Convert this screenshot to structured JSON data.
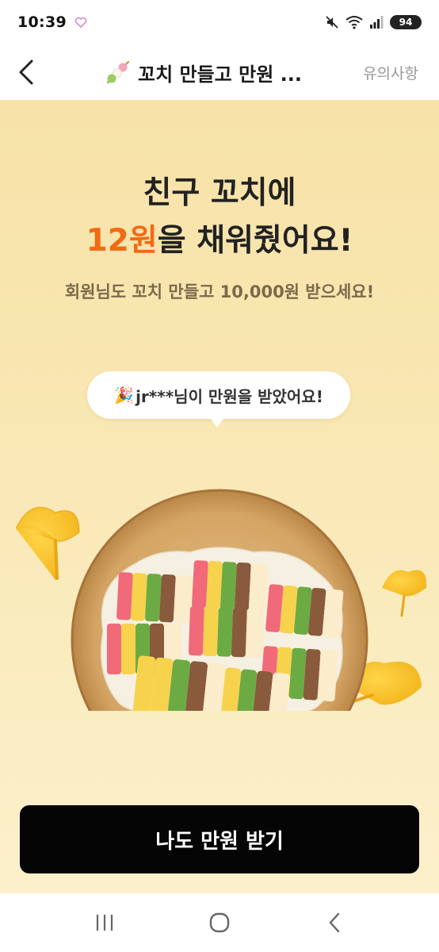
{
  "status_bar": {
    "time": "10:39",
    "battery": "94",
    "icons": [
      "heart-outline-icon",
      "mute-icon",
      "wifi-icon",
      "signal-icon",
      "battery-icon"
    ]
  },
  "header": {
    "back_icon": "chevron-left-icon",
    "title_icon": "skewer-icon",
    "title": "꼬치 만들고 만원 ...",
    "notice_link": "유의사항"
  },
  "hero": {
    "headline_line1": "친구 꼬치에",
    "headline_amount": "12원",
    "headline_rest": "을 채워줬어요!",
    "subline": "회원님도 꼬치 만들고 10,000원 받으세요!",
    "bubble_icon": "party-popper-icon",
    "bubble_text": "jr***님이 만원을 받았어요!"
  },
  "cta": {
    "label": "나도 만원 받기"
  },
  "nav": {
    "recent_icon": "recent-apps-icon",
    "home_icon": "home-icon",
    "back_icon": "back-icon"
  },
  "colors": {
    "accent": "#f26a13",
    "background_top": "#f7e3a8",
    "background_bottom": "#fcf0cc",
    "cta_bg": "#050505"
  }
}
